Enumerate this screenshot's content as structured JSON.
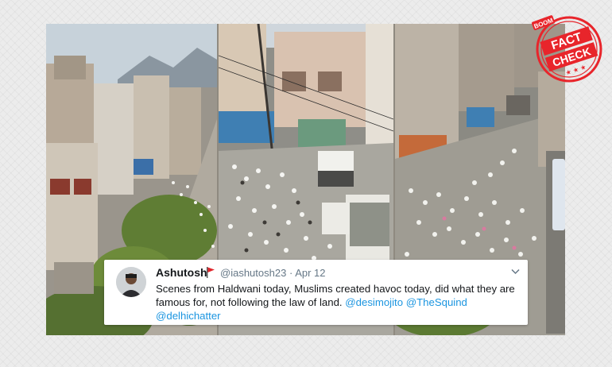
{
  "tweet": {
    "display_name": "Ashutosh",
    "handle": "@iashutosh23",
    "separator": "·",
    "date": "Apr 12",
    "text": "Scenes from Haldwani today, Muslims created havoc today, did what they are famous for, not following the law of land.",
    "mentions": [
      "@desimojito",
      "@TheSquind",
      "@delhichatter"
    ],
    "flag_icon": "red-flag-emoji",
    "menu_icon": "chevron-down-icon"
  },
  "stamp": {
    "brand": "BOOM",
    "line1": "FACT",
    "line2": "CHECK",
    "color": "#e8252b"
  },
  "colors": {
    "link": "#1b95e0",
    "text": "#14171a",
    "muted": "#657786"
  }
}
